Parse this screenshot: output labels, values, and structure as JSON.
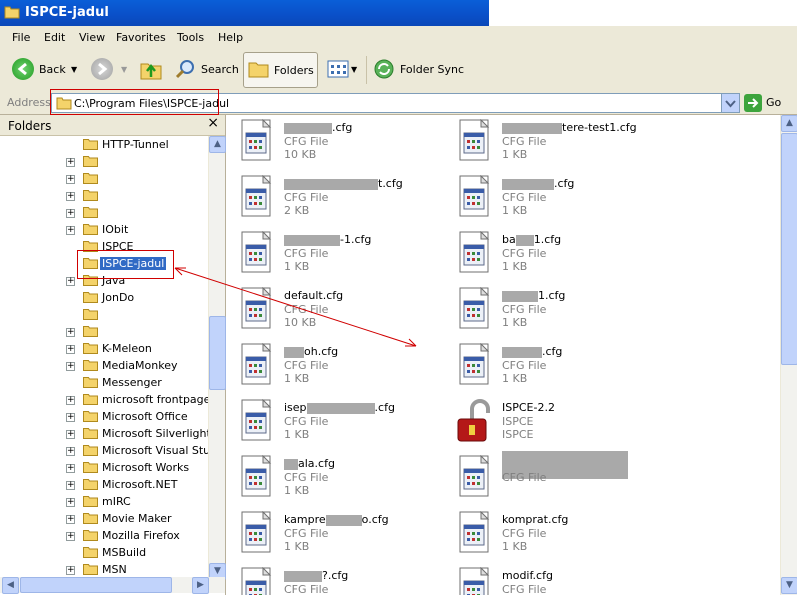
{
  "window": {
    "title": "ISPCE-jadul"
  },
  "menu": [
    "File",
    "Edit",
    "View",
    "Favorites",
    "Tools",
    "Help"
  ],
  "toolbar": {
    "back": "Back",
    "search": "Search",
    "folders": "Folders",
    "folder_sync": "Folder Sync"
  },
  "address": {
    "label": "Address",
    "value": "C:\\Program Files\\ISPCE-jadul",
    "go": "Go"
  },
  "folders_pane": {
    "title": "Folders",
    "close": "×"
  },
  "tree": [
    {
      "label": "HTTP-Tunnel",
      "exp": false
    },
    {
      "label": "",
      "exp": true
    },
    {
      "label": "",
      "exp": true
    },
    {
      "label": "",
      "exp": true
    },
    {
      "label": "",
      "exp": true
    },
    {
      "label": "IObit",
      "exp": true
    },
    {
      "label": "ISPCE",
      "exp": false
    },
    {
      "label": "ISPCE-jadul",
      "exp": false,
      "selected": true
    },
    {
      "label": "Java",
      "exp": true
    },
    {
      "label": "JonDo",
      "exp": false
    },
    {
      "label": "",
      "exp": false
    },
    {
      "label": "",
      "exp": true
    },
    {
      "label": "K-Meleon",
      "exp": true
    },
    {
      "label": "MediaMonkey",
      "exp": true
    },
    {
      "label": "Messenger",
      "exp": false
    },
    {
      "label": "microsoft frontpage",
      "exp": true
    },
    {
      "label": "Microsoft Office",
      "exp": true
    },
    {
      "label": "Microsoft Silverlight",
      "exp": true
    },
    {
      "label": "Microsoft Visual Studio",
      "exp": true
    },
    {
      "label": "Microsoft Works",
      "exp": true
    },
    {
      "label": "Microsoft.NET",
      "exp": true
    },
    {
      "label": "mIRC",
      "exp": true
    },
    {
      "label": "Movie Maker",
      "exp": true
    },
    {
      "label": "Mozilla Firefox",
      "exp": true
    },
    {
      "label": "MSBuild",
      "exp": false
    },
    {
      "label": "MSN",
      "exp": true
    }
  ],
  "files": [
    {
      "pre": "",
      "blur": 48,
      "post": ".cfg",
      "type": "CFG File",
      "size": "10 KB"
    },
    {
      "pre": "",
      "blur": 60,
      "post": "tere-test1.cfg",
      "type": "CFG File",
      "size": "1 KB"
    },
    {
      "pre": "",
      "blur": 94,
      "post": "t.cfg",
      "type": "CFG File",
      "size": "2 KB"
    },
    {
      "pre": "",
      "blur": 52,
      "post": ".cfg",
      "type": "CFG File",
      "size": "1 KB"
    },
    {
      "pre": "",
      "blur": 56,
      "post": "-1.cfg",
      "type": "CFG File",
      "size": "1 KB"
    },
    {
      "pre": "ba",
      "blur": 18,
      "post": "1.cfg",
      "type": "CFG File",
      "size": "1 KB"
    },
    {
      "pre": "default.cfg",
      "blur": 0,
      "post": "",
      "type": "CFG File",
      "size": "10 KB"
    },
    {
      "pre": "",
      "blur": 36,
      "post": "1.cfg",
      "type": "CFG File",
      "size": "1 KB"
    },
    {
      "pre": "",
      "blur": 20,
      "post": "oh.cfg",
      "type": "CFG File",
      "size": "1 KB"
    },
    {
      "pre": "",
      "blur": 40,
      "post": ".cfg",
      "type": "CFG File",
      "size": "1 KB"
    },
    {
      "pre": "isep",
      "blur": 68,
      "post": ".cfg",
      "type": "CFG File",
      "size": "1 KB"
    },
    {
      "pre": "ISPCE-2.2",
      "blur": 0,
      "post": "",
      "type": "ISPCE",
      "size": "ISPCE",
      "lock": true
    },
    {
      "pre": "",
      "blur": 14,
      "post": "ala.cfg",
      "type": "CFG File",
      "size": "1 KB"
    },
    {
      "pre": "",
      "blur": 126,
      "post": "",
      "type": "CFG File",
      "size": "",
      "bigblur": true
    },
    {
      "pre": "kampre",
      "blur": 36,
      "post": "o.cfg",
      "type": "CFG File",
      "size": "1 KB"
    },
    {
      "pre": "komprat.cfg",
      "blur": 0,
      "post": "",
      "type": "CFG File",
      "size": "1 KB"
    },
    {
      "pre": "",
      "blur": 38,
      "post": "?.cfg",
      "type": "CFG File",
      "size": ""
    },
    {
      "pre": "modif.cfg",
      "blur": 0,
      "post": "",
      "type": "CFG File",
      "size": ""
    }
  ]
}
